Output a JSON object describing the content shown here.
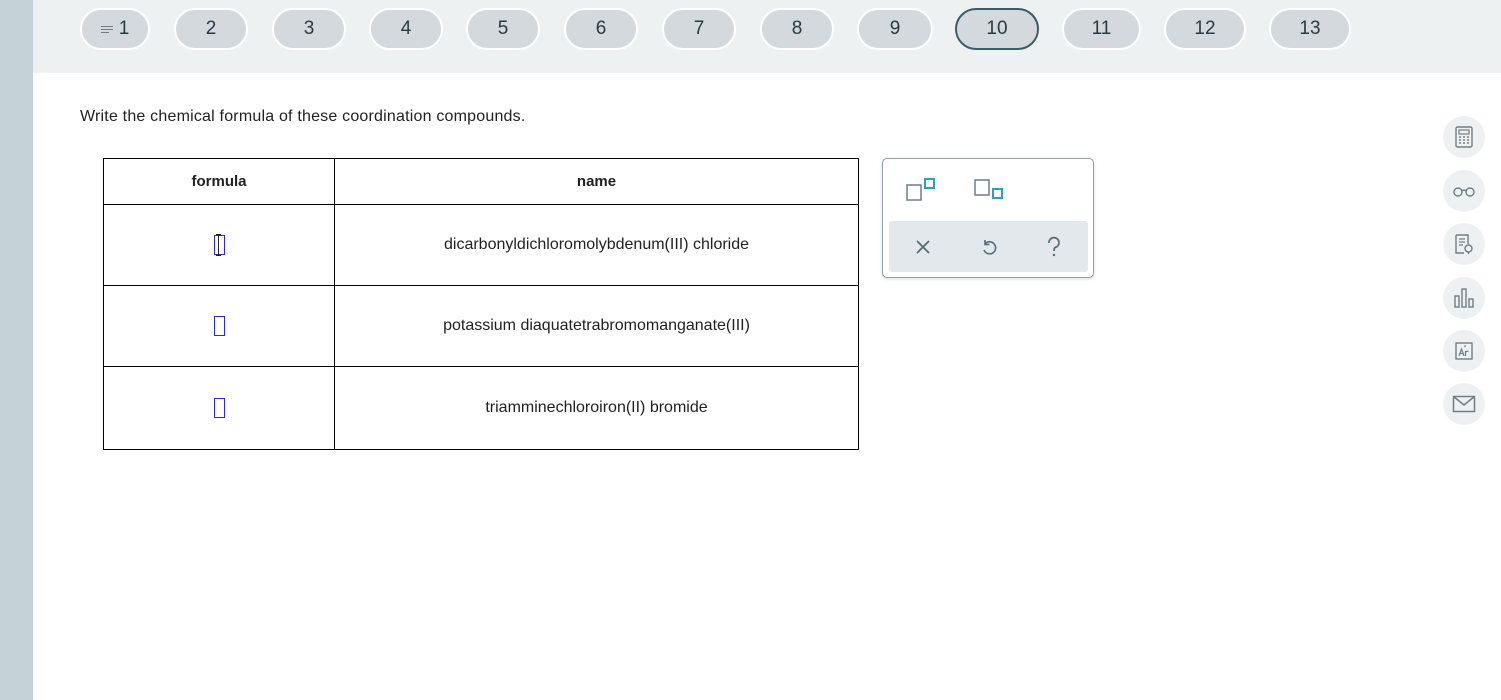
{
  "nav": {
    "questions": [
      {
        "label": "1",
        "has_menu_icon": true
      },
      {
        "label": "2"
      },
      {
        "label": "3"
      },
      {
        "label": "4"
      },
      {
        "label": "5"
      },
      {
        "label": "6"
      },
      {
        "label": "7"
      },
      {
        "label": "8"
      },
      {
        "label": "9"
      },
      {
        "label": "10",
        "active": true
      },
      {
        "label": "11"
      },
      {
        "label": "12"
      },
      {
        "label": "13"
      }
    ]
  },
  "question": {
    "instruction": "Write the chemical formula of these coordination compounds."
  },
  "table": {
    "headers": {
      "formula": "formula",
      "name": "name"
    },
    "rows": [
      {
        "formula": "",
        "name": "dicarbonyldichloromolybdenum(III) chloride"
      },
      {
        "formula": "",
        "name": "potassium diaquatetrabromomanganate(III)"
      },
      {
        "formula": "",
        "name": "triamminechloroiron(II) bromide"
      }
    ]
  },
  "toolbox": {
    "tools": [
      "superscript-icon",
      "subscript-icon"
    ],
    "actions": [
      "clear-icon",
      "undo-icon",
      "help-icon"
    ]
  },
  "sidebar": {
    "icons": [
      "calculator-icon",
      "glasses-icon",
      "notes-icon",
      "bar-chart-icon",
      "periodic-table-icon",
      "mail-icon"
    ]
  },
  "colors": {
    "accent": "#2aa3b8",
    "slot_border": "#2b2bd6",
    "active_pill_border": "#3e5b68",
    "rail": "#c5d2d7"
  }
}
